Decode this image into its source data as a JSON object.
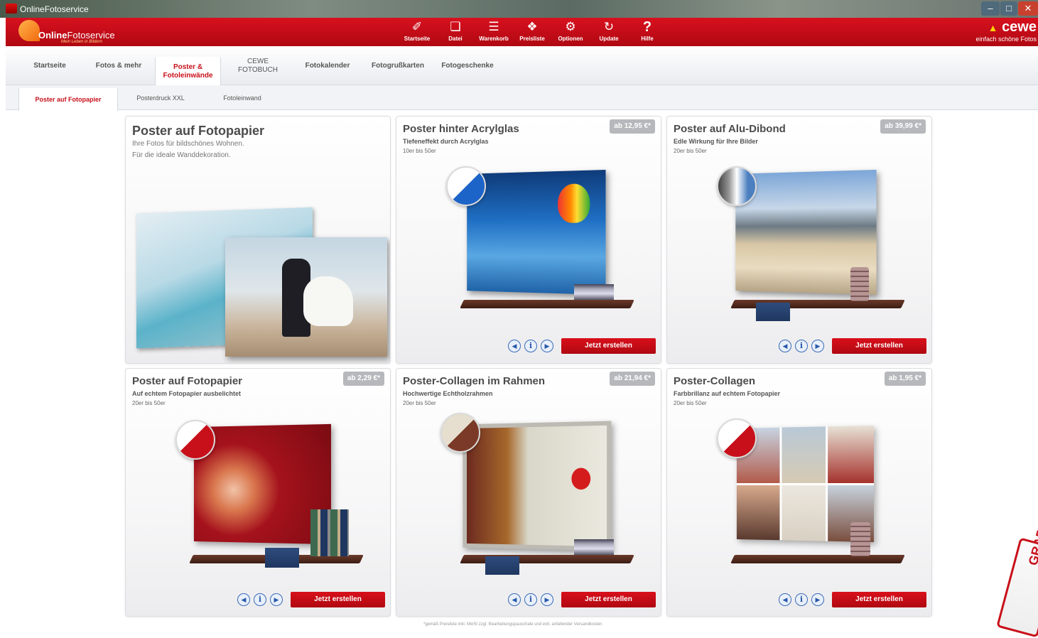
{
  "window": {
    "title": "OnlineFotoservice",
    "minimize": "–",
    "maximize": "□",
    "close": "✕"
  },
  "header": {
    "logo": {
      "brand_bold": "Online",
      "brand_rest": "Fotoservice",
      "slogan": "Mein Leben in Bildern"
    },
    "toolbar": [
      {
        "label": "Startseite",
        "icon": "home-icon",
        "glyph": "✐"
      },
      {
        "label": "Datei",
        "icon": "file-icon",
        "glyph": "❏"
      },
      {
        "label": "Warenkorb",
        "icon": "cart-icon",
        "glyph": "☰"
      },
      {
        "label": "Preisliste",
        "icon": "pricelist-icon",
        "glyph": "❖"
      },
      {
        "label": "Optionen",
        "icon": "gears-icon",
        "glyph": "⚙"
      },
      {
        "label": "Update",
        "icon": "update-icon",
        "glyph": "↻"
      },
      {
        "label": "Hilfe",
        "icon": "help-icon",
        "glyph": "?"
      }
    ],
    "cewe": {
      "name": "cewe",
      "tagline": "einfach schöne Fotos"
    }
  },
  "main_nav": [
    {
      "label": "Startseite"
    },
    {
      "label": "Fotos & mehr"
    },
    {
      "label": "Poster & Fotoleinwände",
      "active": true
    },
    {
      "label": "CEWE FOTOBUCH"
    },
    {
      "label": "Fotokalender"
    },
    {
      "label": "Fotogrußkarten"
    },
    {
      "label": "Fotogeschenke"
    }
  ],
  "sub_nav": [
    {
      "label": "Poster auf Fotopapier",
      "active": true
    },
    {
      "label": "Posterdruck XXL"
    },
    {
      "label": "Fotoleinwand"
    }
  ],
  "hero": {
    "title": "Poster auf Fotopapier",
    "line1": "Ihre Fotos für bildschönes Wohnen.",
    "line2": "Für die ideale Wanddekoration."
  },
  "products": [
    {
      "title": "Poster hinter Acrylglas",
      "subtitle": "Tiefeneffekt durch Acrylglas",
      "range": "10er bis 50er",
      "price": "ab 12,95 €*",
      "button": "Jetzt erstellen"
    },
    {
      "title": "Poster auf Alu-Dibond",
      "subtitle": "Edle Wirkung für Ihre Bilder",
      "range": "20er bis 50er",
      "price": "ab 39,99 €*",
      "button": "Jetzt erstellen"
    },
    {
      "title": "Poster auf Fotopapier",
      "subtitle": "Auf echtem Fotopapier ausbelichtet",
      "range": "20er bis 50er",
      "price": "ab 2,29 €*",
      "button": "Jetzt erstellen"
    },
    {
      "title": "Poster-Collagen im Rahmen",
      "subtitle": "Hochwertige Echtholzrahmen",
      "range": "20er bis 50er",
      "price": "ab 21,94 €*",
      "button": "Jetzt erstellen"
    },
    {
      "title": "Poster-Collagen",
      "subtitle": "Farbbrillanz auf echtem Fotopapier",
      "range": "20er bis 50er",
      "price": "ab 1,95 €*",
      "button": "Jetzt erstellen"
    }
  ],
  "controls": {
    "prev": "◀",
    "info": "i",
    "next": "▶"
  },
  "footnote": "*gemäß Preisliste inkl. MwSt zzgl. Bearbeitungspauschale und evtl. anfallender Versandkosten",
  "corner_graphic": "GRAPH",
  "colors": {
    "brand_red": "#c8101a",
    "price_badge": "#b6b8bb",
    "control_blue": "#3769b6"
  }
}
